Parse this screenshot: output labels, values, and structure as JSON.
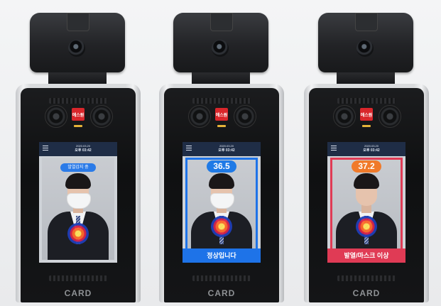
{
  "devices": [
    {
      "brand_badge": "에스원",
      "clock": {
        "date": "2020.03.20",
        "time": "오후 03:42"
      },
      "status_pill": "발열감지 중",
      "temperature": "",
      "result": "",
      "card_label": "CARD",
      "mask": true,
      "accent": "#1e73e8"
    },
    {
      "brand_badge": "에스원",
      "clock": {
        "date": "2020.03.20",
        "time": "오후 03:42"
      },
      "status_pill": "",
      "temperature": "36.5",
      "result": "정상입니다",
      "card_label": "CARD",
      "mask": true,
      "accent": "#1e73e8"
    },
    {
      "brand_badge": "에스원",
      "clock": {
        "date": "2020.03.20",
        "time": "오후 03:42"
      },
      "status_pill": "",
      "temperature": "37.2",
      "result": "발열/마스크 이상",
      "card_label": "CARD",
      "mask": false,
      "accent": "#e03b55"
    }
  ],
  "icons": {
    "camera": "camera-lens-icon",
    "menu": "hamburger-menu-icon",
    "thermal": "thermal-heatmap-icon"
  }
}
